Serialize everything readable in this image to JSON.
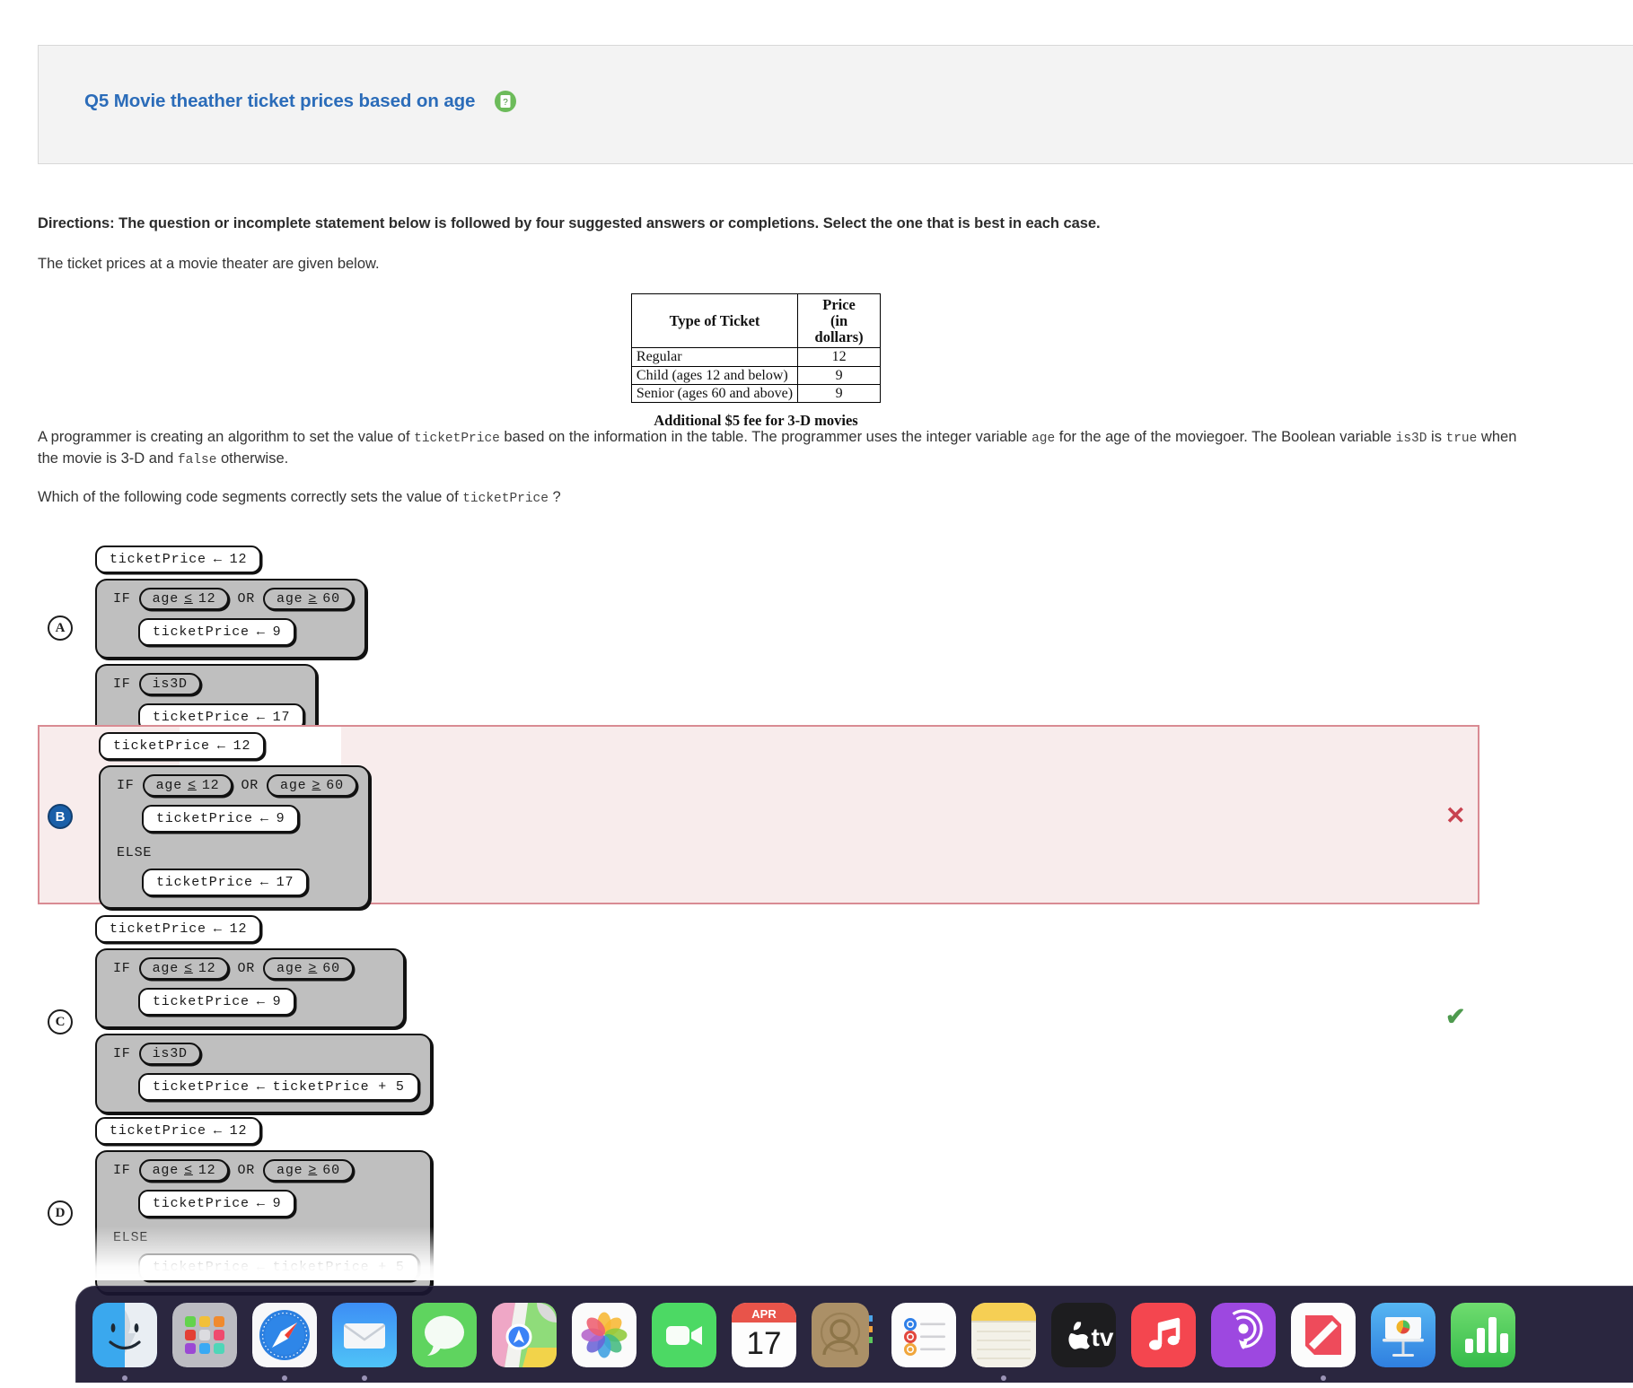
{
  "header": {
    "title": "Q5 Movie theather ticket prices based on age",
    "help_icon": "question-document-icon",
    "title_color": "#2b6cb9",
    "help_icon_color": "#6cbb5a"
  },
  "body": {
    "directions": "Directions: The question or incomplete statement below is followed by four suggested answers or completions. Select the one that is best in each case.",
    "intro": "The ticket prices at a movie theater are given below.",
    "paragraph_1_parts": {
      "a": "A programmer is creating an algorithm to set the value of ",
      "code1": "ticketPrice",
      "b": " based on the information in the table. The programmer uses the integer  variable ",
      "code2": "age",
      "c": " for the age of the moviegoer. The Boolean variable ",
      "code3": "is3D",
      "d": " is ",
      "code4": "true",
      "e": " when the movie is 3-D and ",
      "code5": "false",
      "f": " otherwise."
    },
    "paragraph_2_parts": {
      "a": "Which of the following code segments correctly sets the value of ",
      "code1": "ticketPrice",
      "b": " ?"
    }
  },
  "price_table": {
    "headers": [
      "Type of Ticket",
      "Price (in dollars)"
    ],
    "header_price_line1": "Price",
    "header_price_line2": "(in dollars)",
    "rows": [
      {
        "type": "Regular",
        "price": "12"
      },
      {
        "type": "Child (ages 12 and below)",
        "price": "9"
      },
      {
        "type": "Senior (ages 60 and above)",
        "price": "9"
      }
    ],
    "note": "Additional $5 fee for 3-D movies"
  },
  "options": [
    {
      "letter": "A",
      "selected": false,
      "verdict": "",
      "lines": {
        "init": {
          "var": "ticketPrice",
          "arrow": "←",
          "value": "12"
        },
        "if1_kw": "IF",
        "cond_left": {
          "left": "age",
          "op": "≤",
          "right": "12"
        },
        "or": "OR",
        "cond_right": {
          "left": "age",
          "op": "≥",
          "right": "60"
        },
        "body1": {
          "var": "ticketPrice",
          "arrow": "←",
          "value": "9"
        },
        "if2_kw": "IF",
        "cond_is3d": "is3D",
        "body2": {
          "var": "ticketPrice",
          "arrow": "←",
          "value": "17"
        }
      }
    },
    {
      "letter": "B",
      "selected": true,
      "verdict": "✕",
      "verdict_kind": "wrong",
      "lines": {
        "init": {
          "var": "ticketPrice",
          "arrow": "←",
          "value": "12"
        },
        "if1_kw": "IF",
        "cond_left": {
          "left": "age",
          "op": "≤",
          "right": "12"
        },
        "or": "OR",
        "cond_right": {
          "left": "age",
          "op": "≥",
          "right": "60"
        },
        "body1": {
          "var": "ticketPrice",
          "arrow": "←",
          "value": "9"
        },
        "else_kw": "ELSE",
        "body2": {
          "var": "ticketPrice",
          "arrow": "←",
          "value": "17"
        }
      }
    },
    {
      "letter": "C",
      "selected": false,
      "verdict": "✔",
      "verdict_kind": "right",
      "lines": {
        "init": {
          "var": "ticketPrice",
          "arrow": "←",
          "value": "12"
        },
        "if1_kw": "IF",
        "cond_left": {
          "left": "age",
          "op": "≤",
          "right": "12"
        },
        "or": "OR",
        "cond_right": {
          "left": "age",
          "op": "≥",
          "right": "60"
        },
        "body1": {
          "var": "ticketPrice",
          "arrow": "←",
          "value": "9"
        },
        "if2_kw": "IF",
        "cond_is3d": "is3D",
        "body2": {
          "var": "ticketPrice",
          "arrow": "←",
          "value": "ticketPrice + 5"
        }
      }
    },
    {
      "letter": "D",
      "selected": false,
      "verdict": "",
      "lines": {
        "init": {
          "var": "ticketPrice",
          "arrow": "←",
          "value": "12"
        },
        "if1_kw": "IF",
        "cond_left": {
          "left": "age",
          "op": "≤",
          "right": "12"
        },
        "or": "OR",
        "cond_right": {
          "left": "age",
          "op": "≥",
          "right": "60"
        },
        "body1": {
          "var": "ticketPrice",
          "arrow": "←",
          "value": "9"
        },
        "else_kw": "ELSE",
        "body2": {
          "var": "ticketPrice",
          "arrow": "←",
          "value": "ticketPrice + 5"
        }
      }
    }
  ],
  "dock": {
    "items": [
      {
        "name": "finder-icon",
        "label": "Finder",
        "running": true
      },
      {
        "name": "launchpad-icon",
        "label": "Launchpad",
        "running": false
      },
      {
        "name": "safari-icon",
        "label": "Safari",
        "running": true
      },
      {
        "name": "mail-icon",
        "label": "Mail",
        "running": true
      },
      {
        "name": "messages-icon",
        "label": "Messages",
        "running": false
      },
      {
        "name": "maps-icon",
        "label": "Maps",
        "running": false
      },
      {
        "name": "photos-icon",
        "label": "Photos",
        "running": false
      },
      {
        "name": "facetime-icon",
        "label": "FaceTime",
        "running": false
      },
      {
        "name": "calendar-icon",
        "label": "Calendar",
        "running": false,
        "month": "APR",
        "day": "17"
      },
      {
        "name": "contacts-icon",
        "label": "Contacts",
        "running": false
      },
      {
        "name": "reminders-icon",
        "label": "Reminders",
        "running": false
      },
      {
        "name": "notes-icon",
        "label": "Notes",
        "running": true
      },
      {
        "name": "appletv-icon",
        "label": "Apple TV",
        "running": false
      },
      {
        "name": "music-icon",
        "label": "Music",
        "running": false
      },
      {
        "name": "podcasts-icon",
        "label": "Podcasts",
        "running": false
      },
      {
        "name": "news-icon",
        "label": "News",
        "running": true
      },
      {
        "name": "keynote-icon",
        "label": "Keynote",
        "running": false
      },
      {
        "name": "numbers-icon",
        "label": "Numbers",
        "running": false
      }
    ]
  }
}
